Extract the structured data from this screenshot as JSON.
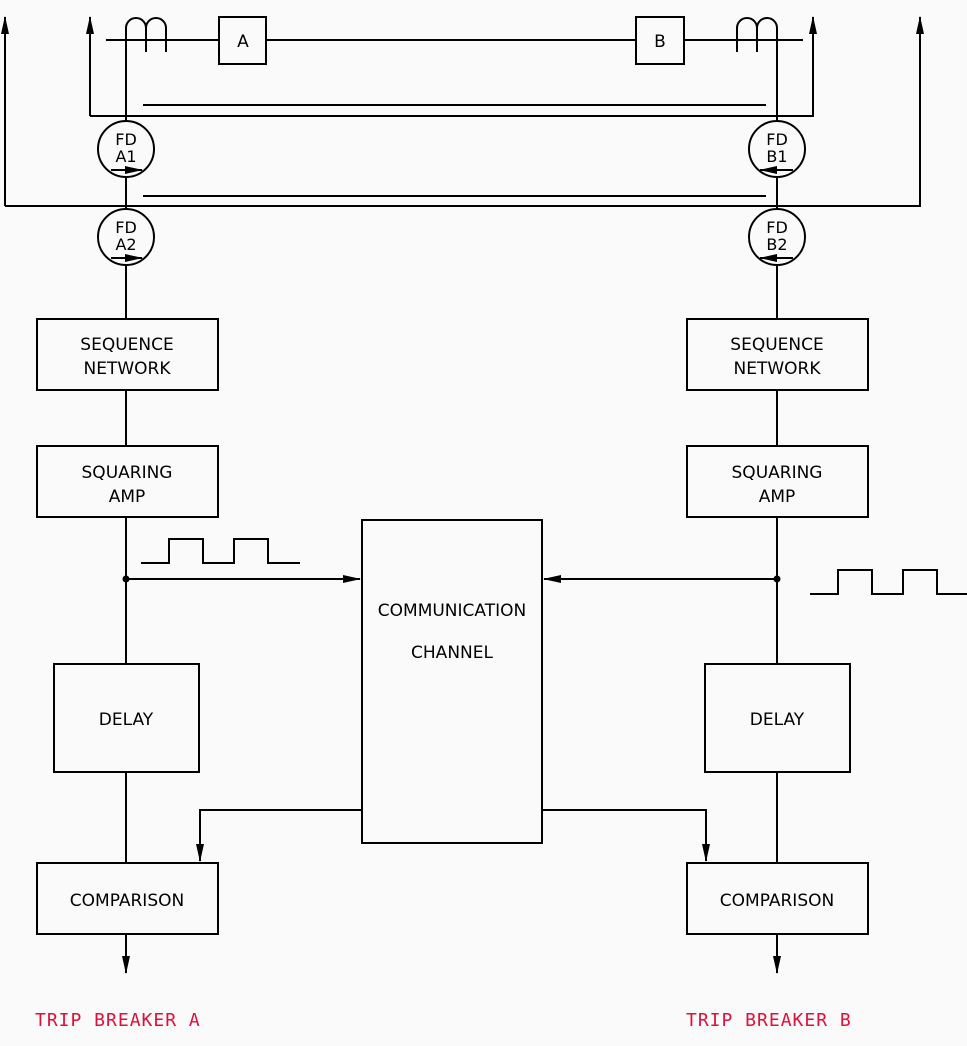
{
  "diagram": {
    "breakers": {
      "a": "A",
      "b": "B"
    },
    "detectors": {
      "a1": {
        "line1": "FD",
        "line2": "A1"
      },
      "a2": {
        "line1": "FD",
        "line2": "A2"
      },
      "b1": {
        "line1": "FD",
        "line2": "B1"
      },
      "b2": {
        "line1": "FD",
        "line2": "B2"
      }
    },
    "left": {
      "sequence_network": [
        "SEQUENCE",
        "NETWORK"
      ],
      "squaring_amp": [
        "SQUARING",
        "AMP"
      ],
      "delay": "DELAY",
      "comparison": "COMPARISON",
      "trip": "TRIP BREAKER A"
    },
    "right": {
      "sequence_network": [
        "SEQUENCE",
        "NETWORK"
      ],
      "squaring_amp": [
        "SQUARING",
        "AMP"
      ],
      "delay": "DELAY",
      "comparison": "COMPARISON",
      "trip": "TRIP BREAKER B"
    },
    "channel": [
      "COMMUNICATION",
      "CHANNEL"
    ],
    "colors": {
      "line": "#000000",
      "trip_text": "#e0103a",
      "background": "#fafafa"
    }
  }
}
